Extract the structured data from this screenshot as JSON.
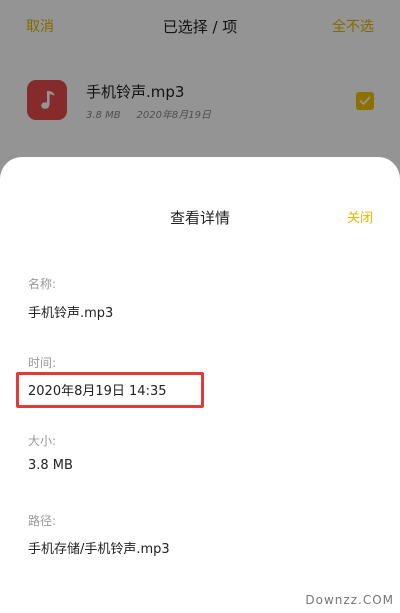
{
  "topbar": {
    "cancel_label": "取消",
    "title": "已选择 / 项",
    "unselect_label": "全不选"
  },
  "file": {
    "name": "手机铃声.mp3",
    "size": "3.8 MB",
    "date": "2020年8月19日",
    "selected": true,
    "icon": "music-note-icon"
  },
  "sheet": {
    "title": "查看详情",
    "close_label": "关闭",
    "fields": {
      "name_label": "名称:",
      "name_value": "手机铃声.mp3",
      "time_label": "时间:",
      "time_value": "2020年8月19日 14:35",
      "size_label": "大小:",
      "size_value": "3.8 MB",
      "path_label": "路径:",
      "path_value": "手机存储/手机铃声.mp3"
    }
  },
  "watermark": "Downzz.COM",
  "colors": {
    "accent": "#e0b800",
    "checkbox": "#f2c200",
    "app_icon": "#e54a4a",
    "highlight_box": "#e03a3a"
  }
}
